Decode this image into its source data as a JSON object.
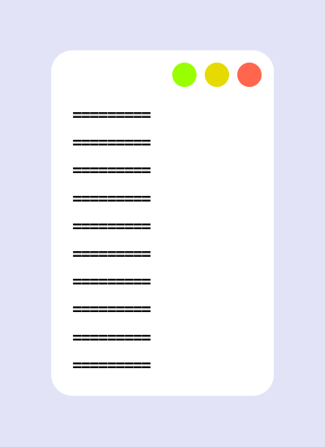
{
  "window": {
    "controls": [
      {
        "name": "green",
        "color": "#99ff00"
      },
      {
        "name": "yellow",
        "color": "#e5db00"
      },
      {
        "name": "red",
        "color": "#ff664d"
      }
    ],
    "lines": [
      "=========",
      "=========",
      "=========",
      "=========",
      "=========",
      "=========",
      "=========",
      "=========",
      "=========",
      "========="
    ]
  }
}
